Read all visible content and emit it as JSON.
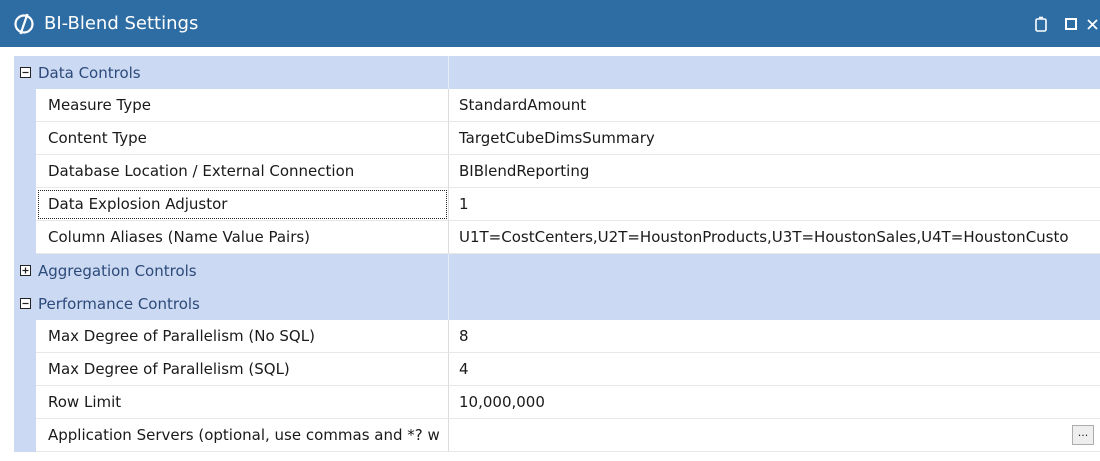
{
  "window": {
    "title": "BI-Blend Settings"
  },
  "icons": {
    "app": "onestream-logo-icon",
    "restore": "restore-icon",
    "maximize": "maximize-icon",
    "close": "close-icon"
  },
  "colors": {
    "titlebar": "#2e6da4",
    "category_band": "#ccd9f2",
    "category_text": "#2c4a7a"
  },
  "sections": [
    {
      "label": "Data Controls",
      "expanded": true,
      "properties": [
        {
          "name": "Measure Type",
          "value": "StandardAmount"
        },
        {
          "name": "Content Type",
          "value": "TargetCubeDimsSummary"
        },
        {
          "name": "Database Location / External Connection",
          "value": "BIBlendReporting"
        },
        {
          "name": "Data Explosion Adjustor",
          "value": "1"
        },
        {
          "name": "Column Aliases (Name Value Pairs)",
          "value": "U1T=CostCenters,U2T=HoustonProducts,U3T=HoustonSales,U4T=HoustonCusto"
        }
      ]
    },
    {
      "label": "Aggregation Controls",
      "expanded": false,
      "properties": []
    },
    {
      "label": "Performance Controls",
      "expanded": true,
      "properties": [
        {
          "name": "Max Degree of Parallelism (No SQL)",
          "value": "8"
        },
        {
          "name": "Max Degree of Parallelism (SQL)",
          "value": "4"
        },
        {
          "name": "Row Limit",
          "value": "10,000,000"
        },
        {
          "name": "Application Servers (optional, use commas and *? w",
          "value": "",
          "button": "..."
        }
      ]
    }
  ]
}
